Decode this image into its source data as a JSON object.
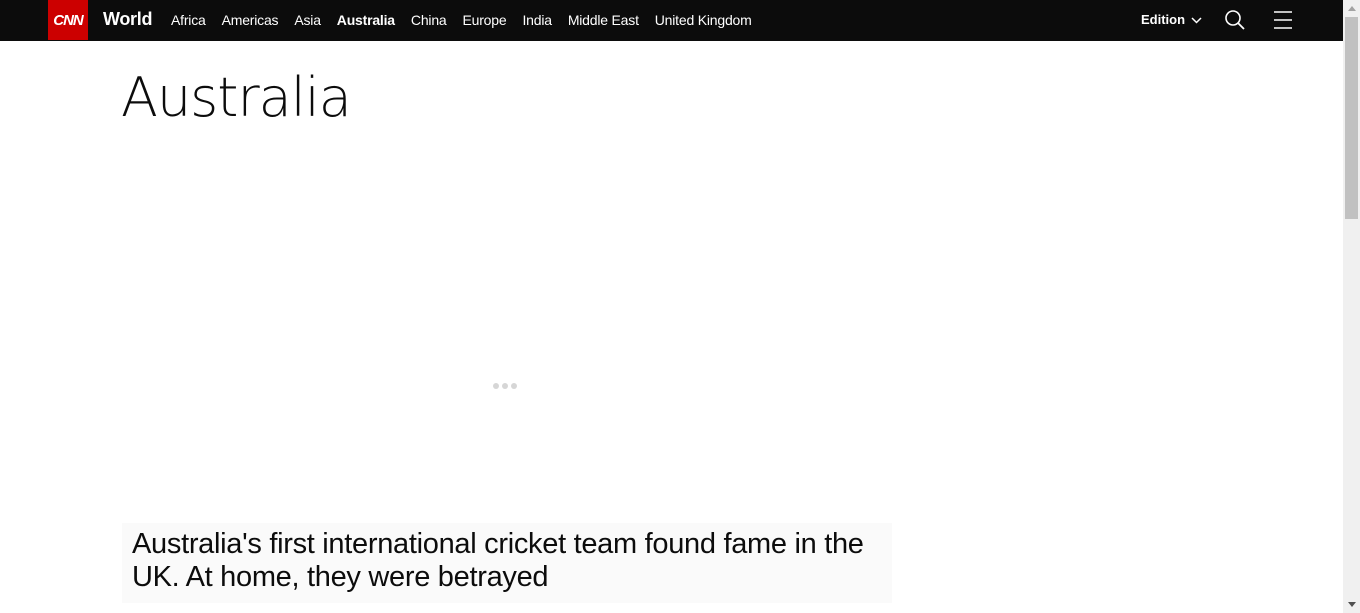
{
  "header": {
    "logo_text": "CNN",
    "section": "World",
    "nav": [
      {
        "label": "Africa",
        "active": false
      },
      {
        "label": "Americas",
        "active": false
      },
      {
        "label": "Asia",
        "active": false
      },
      {
        "label": "Australia",
        "active": true
      },
      {
        "label": "China",
        "active": false
      },
      {
        "label": "Europe",
        "active": false
      },
      {
        "label": "India",
        "active": false
      },
      {
        "label": "Middle East",
        "active": false
      },
      {
        "label": "United Kingdom",
        "active": false
      }
    ],
    "edition_label": "Edition",
    "icons": {
      "search": "search-icon",
      "menu": "hamburger-menu-icon",
      "edition": "chevron-down-icon"
    }
  },
  "main": {
    "title": "Australia",
    "headline": "Australia's first international cricket team found fame in the UK. At home, they were betrayed"
  },
  "colors": {
    "brand_red": "#cc0000",
    "topbar": "#0c0c0c",
    "text": "#0c0c0c"
  }
}
